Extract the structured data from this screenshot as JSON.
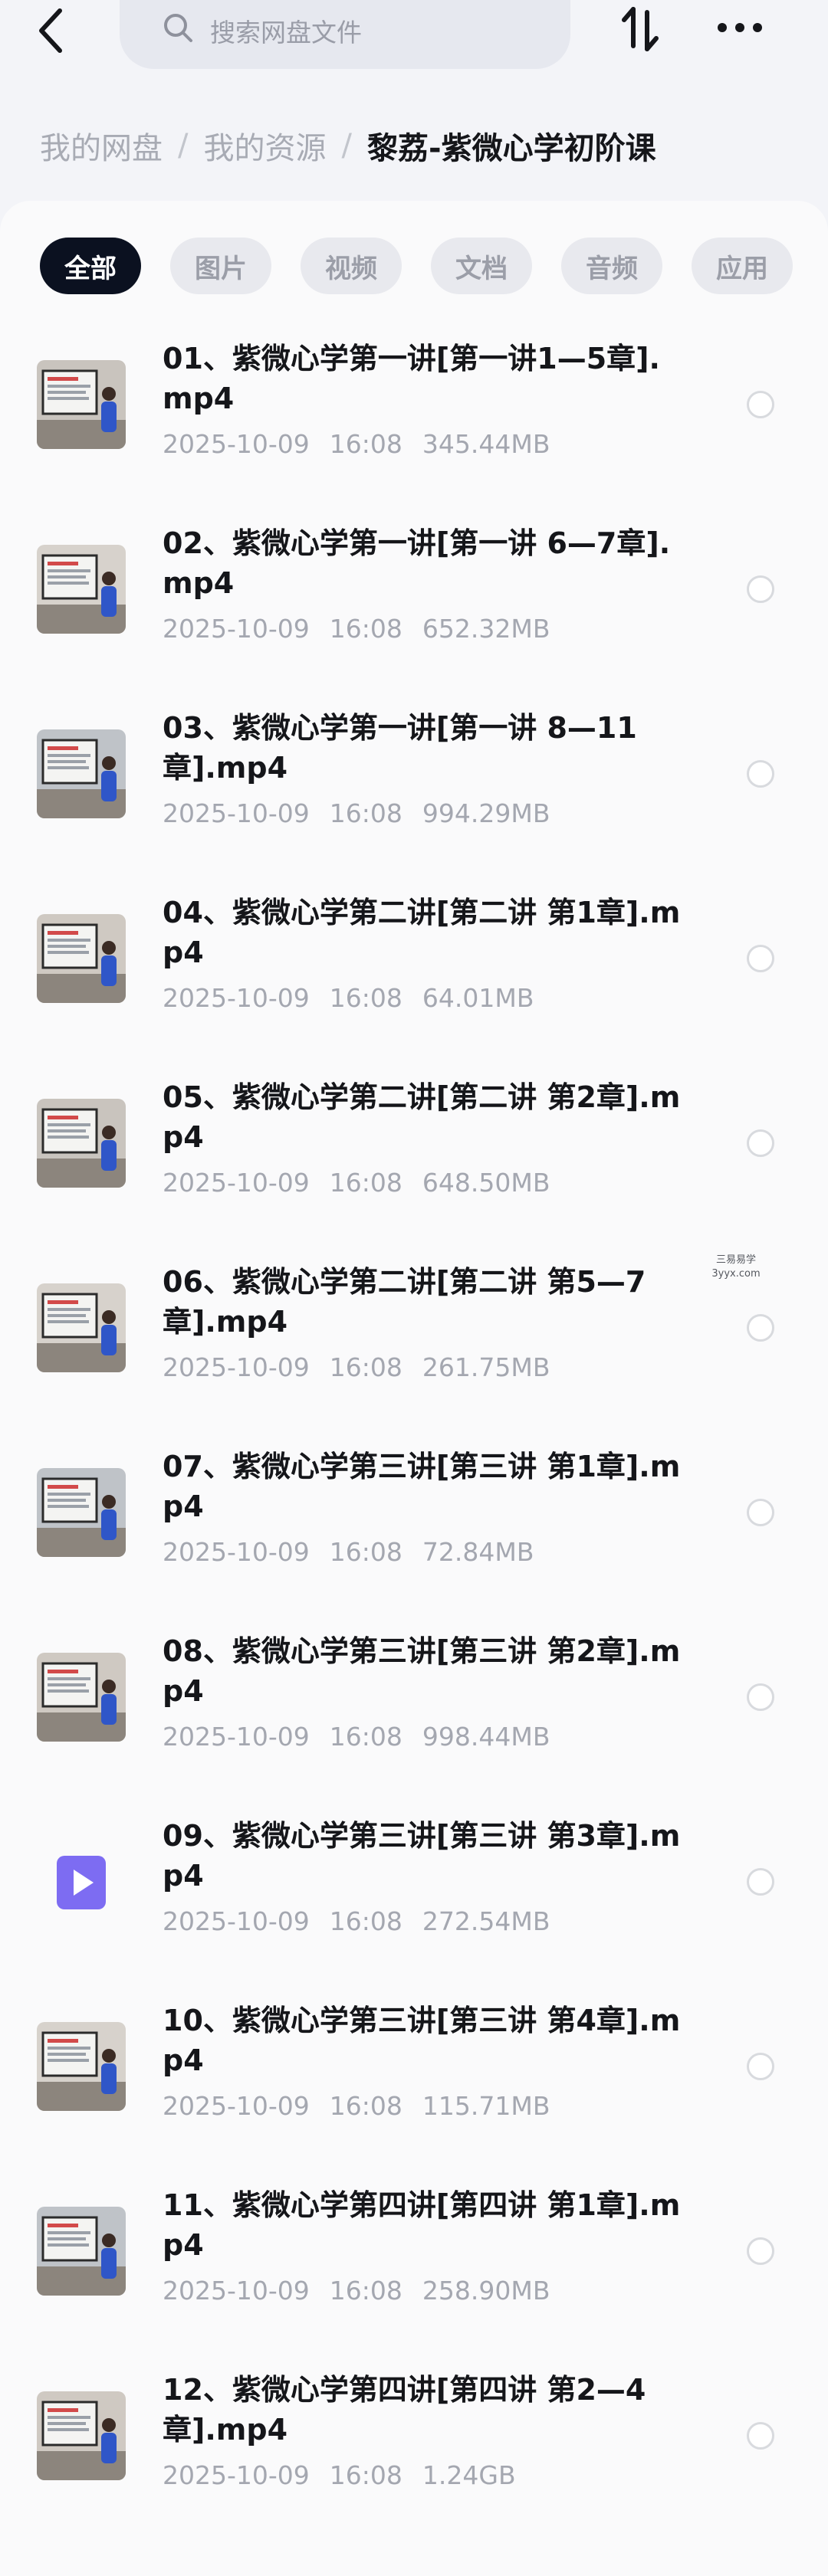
{
  "search": {
    "placeholder": "搜索网盘文件"
  },
  "breadcrumb": {
    "items": [
      "我的网盘",
      "我的资源"
    ],
    "current": "黎荔-紫微心学初阶课"
  },
  "tabs": [
    "全部",
    "图片",
    "视频",
    "文档",
    "音频",
    "应用"
  ],
  "files": [
    {
      "name": "01、紫微心学第一讲[第一讲1—5章].mp4",
      "date": "2025-10-09",
      "time": "16:08",
      "size": "345.44MB",
      "thumb": "lecture-thumbnail-icon"
    },
    {
      "name": "02、紫微心学第一讲[第一讲 6—7章].mp4",
      "date": "2025-10-09",
      "time": "16:08",
      "size": "652.32MB",
      "thumb": "lecture-thumbnail-icon"
    },
    {
      "name": "03、紫微心学第一讲[第一讲 8—11章].mp4",
      "date": "2025-10-09",
      "time": "16:08",
      "size": "994.29MB",
      "thumb": "lecture-thumbnail-icon"
    },
    {
      "name": "04、紫微心学第二讲[第二讲 第1章].mp4",
      "date": "2025-10-09",
      "time": "16:08",
      "size": "64.01MB",
      "thumb": "lecture-thumbnail-icon"
    },
    {
      "name": "05、紫微心学第二讲[第二讲 第2章].mp4",
      "date": "2025-10-09",
      "time": "16:08",
      "size": "648.50MB",
      "thumb": "lecture-thumbnail-icon"
    },
    {
      "name": "06、紫微心学第二讲[第二讲 第5—7章].mp4",
      "date": "2025-10-09",
      "time": "16:08",
      "size": "261.75MB",
      "thumb": "lecture-thumbnail-icon"
    },
    {
      "name": "07、紫微心学第三讲[第三讲 第1章].mp4",
      "date": "2025-10-09",
      "time": "16:08",
      "size": "72.84MB",
      "thumb": "lecture-thumbnail-icon"
    },
    {
      "name": "08、紫微心学第三讲[第三讲 第2章].mp4",
      "date": "2025-10-09",
      "time": "16:08",
      "size": "998.44MB",
      "thumb": "lecture-thumbnail-icon"
    },
    {
      "name": "09、紫微心学第三讲[第三讲 第3章].mp4",
      "date": "2025-10-09",
      "time": "16:08",
      "size": "272.54MB",
      "thumb": "video-file-icon"
    },
    {
      "name": "10、紫微心学第三讲[第三讲 第4章].mp4",
      "date": "2025-10-09",
      "time": "16:08",
      "size": "115.71MB",
      "thumb": "lecture-thumbnail-icon"
    },
    {
      "name": "11、紫微心学第四讲[第四讲 第1章].mp4",
      "date": "2025-10-09",
      "time": "16:08",
      "size": "258.90MB",
      "thumb": "lecture-thumbnail-icon"
    },
    {
      "name": "12、紫微心学第四讲[第四讲 第2—4章].mp4",
      "date": "2025-10-09",
      "time": "16:08",
      "size": "1.24GB",
      "thumb": "lecture-thumbnail-icon"
    }
  ],
  "watermark": {
    "line1": "三易易学",
    "line2": "3yyx.com"
  },
  "colors": {
    "active_tab": "#0b1120",
    "video_icon": "#7d6cf2",
    "background": "#f3f4f8"
  }
}
